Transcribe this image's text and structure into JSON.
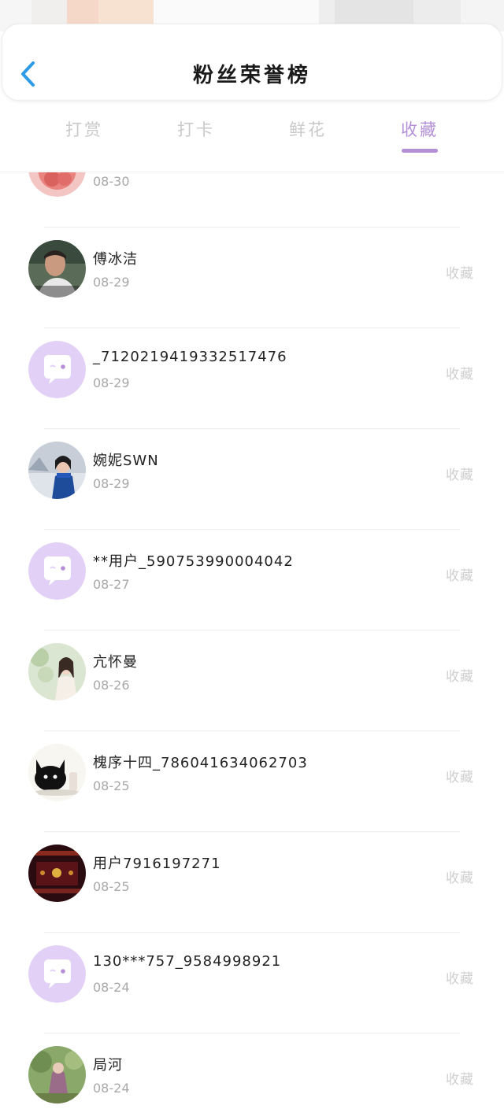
{
  "header": {
    "title": "粉丝荣誉榜"
  },
  "tabs": [
    {
      "label": "打赏",
      "active": false
    },
    {
      "label": "打卡",
      "active": false
    },
    {
      "label": "鲜花",
      "active": false
    },
    {
      "label": "收藏",
      "active": true
    }
  ],
  "colors": {
    "accent": "#b48fd6",
    "back_arrow": "#2e9be8",
    "placeholder_avatar_bg": "#e3d0f7"
  },
  "list": [
    {
      "name": "",
      "date": "08-30",
      "action": "收藏",
      "avatar": "red-flower-avatar"
    },
    {
      "name": "傅冰洁",
      "date": "08-29",
      "action": "收藏",
      "avatar": "photo-avatar"
    },
    {
      "name": "_7120219419332517476",
      "date": "08-29",
      "action": "收藏",
      "avatar": "default-chat-avatar"
    },
    {
      "name": "婉妮SWN",
      "date": "08-29",
      "action": "收藏",
      "avatar": "photo-avatar"
    },
    {
      "name": "**用户_590753990004042",
      "date": "08-27",
      "action": "收藏",
      "avatar": "default-chat-avatar"
    },
    {
      "name": "亢怀曼",
      "date": "08-26",
      "action": "收藏",
      "avatar": "photo-avatar"
    },
    {
      "name": "槐序十四_786041634062703",
      "date": "08-25",
      "action": "收藏",
      "avatar": "black-cat-avatar"
    },
    {
      "name": "用户7916197271",
      "date": "08-25",
      "action": "收藏",
      "avatar": "photo-avatar"
    },
    {
      "name": "130***757_9584998921",
      "date": "08-24",
      "action": "收藏",
      "avatar": "default-chat-avatar"
    },
    {
      "name": "局河",
      "date": "08-24",
      "action": "收藏",
      "avatar": "photo-avatar"
    }
  ]
}
